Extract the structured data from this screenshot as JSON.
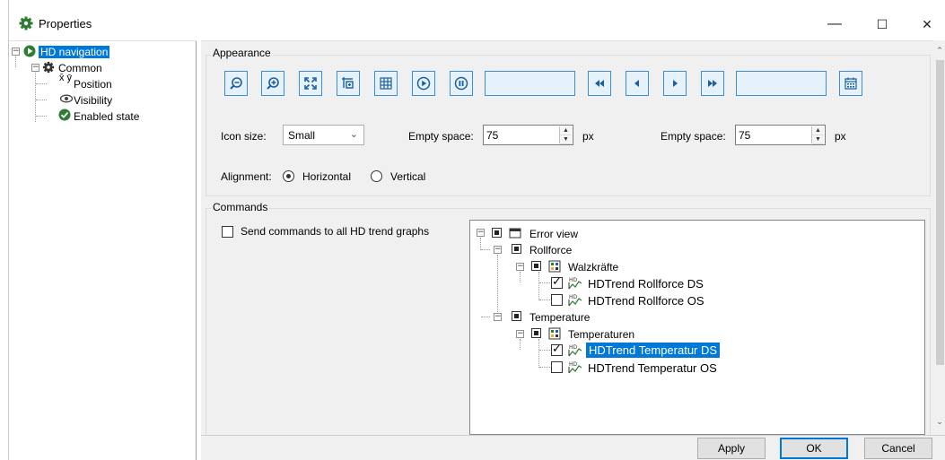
{
  "window": {
    "title": "Properties",
    "min_symbol": "—",
    "max_symbol": "☐",
    "close_symbol": "✕"
  },
  "left_tree": {
    "root": "HD navigation",
    "common": "Common",
    "items": [
      "Position",
      "Visibility",
      "Enabled state"
    ],
    "position_icon_text": "x̄ ȳ"
  },
  "appearance": {
    "title": "Appearance",
    "toolbar_icons": [
      "zoom-out-icon",
      "zoom-in-icon",
      "fit-icon",
      "crosshair-icon",
      "grid-icon",
      "play-icon",
      "pause-icon",
      "rewind-icon",
      "step-back-icon",
      "step-forward-icon",
      "fast-forward-icon",
      "calendar-icon"
    ],
    "icon_size_label": "Icon size:",
    "icon_size_value": "Small",
    "empty_space_label_1": "Empty space:",
    "empty_space_value_1": "75",
    "px_1": "px",
    "empty_space_label_2": "Empty space:",
    "empty_space_value_2": "75",
    "px_2": "px",
    "alignment_label": "Alignment:",
    "horizontal": "Horizontal",
    "vertical": "Vertical",
    "selected_alignment": "Horizontal"
  },
  "commands": {
    "title": "Commands",
    "send_all_label": "Send commands to all HD trend graphs",
    "tree": {
      "root": "Error view",
      "rollforce": "Rollforce",
      "walzkraefte": "Walzkräfte",
      "rollforce_ds": "HDTrend Rollforce DS",
      "rollforce_os": "HDTrend Rollforce OS",
      "temperature": "Temperature",
      "temperaturen": "Temperaturen",
      "temperatur_ds": "HDTrend Temperatur DS",
      "temperatur_os": "HDTrend Temperatur OS"
    }
  },
  "buttons": {
    "apply": "Apply",
    "ok": "OK",
    "cancel": "Cancel"
  },
  "colors": {
    "accent": "#0078d7",
    "toolbar_fill": "#e5f1fb",
    "toolbar_border": "#3b8fd6",
    "panel": "#f0f0f0"
  }
}
